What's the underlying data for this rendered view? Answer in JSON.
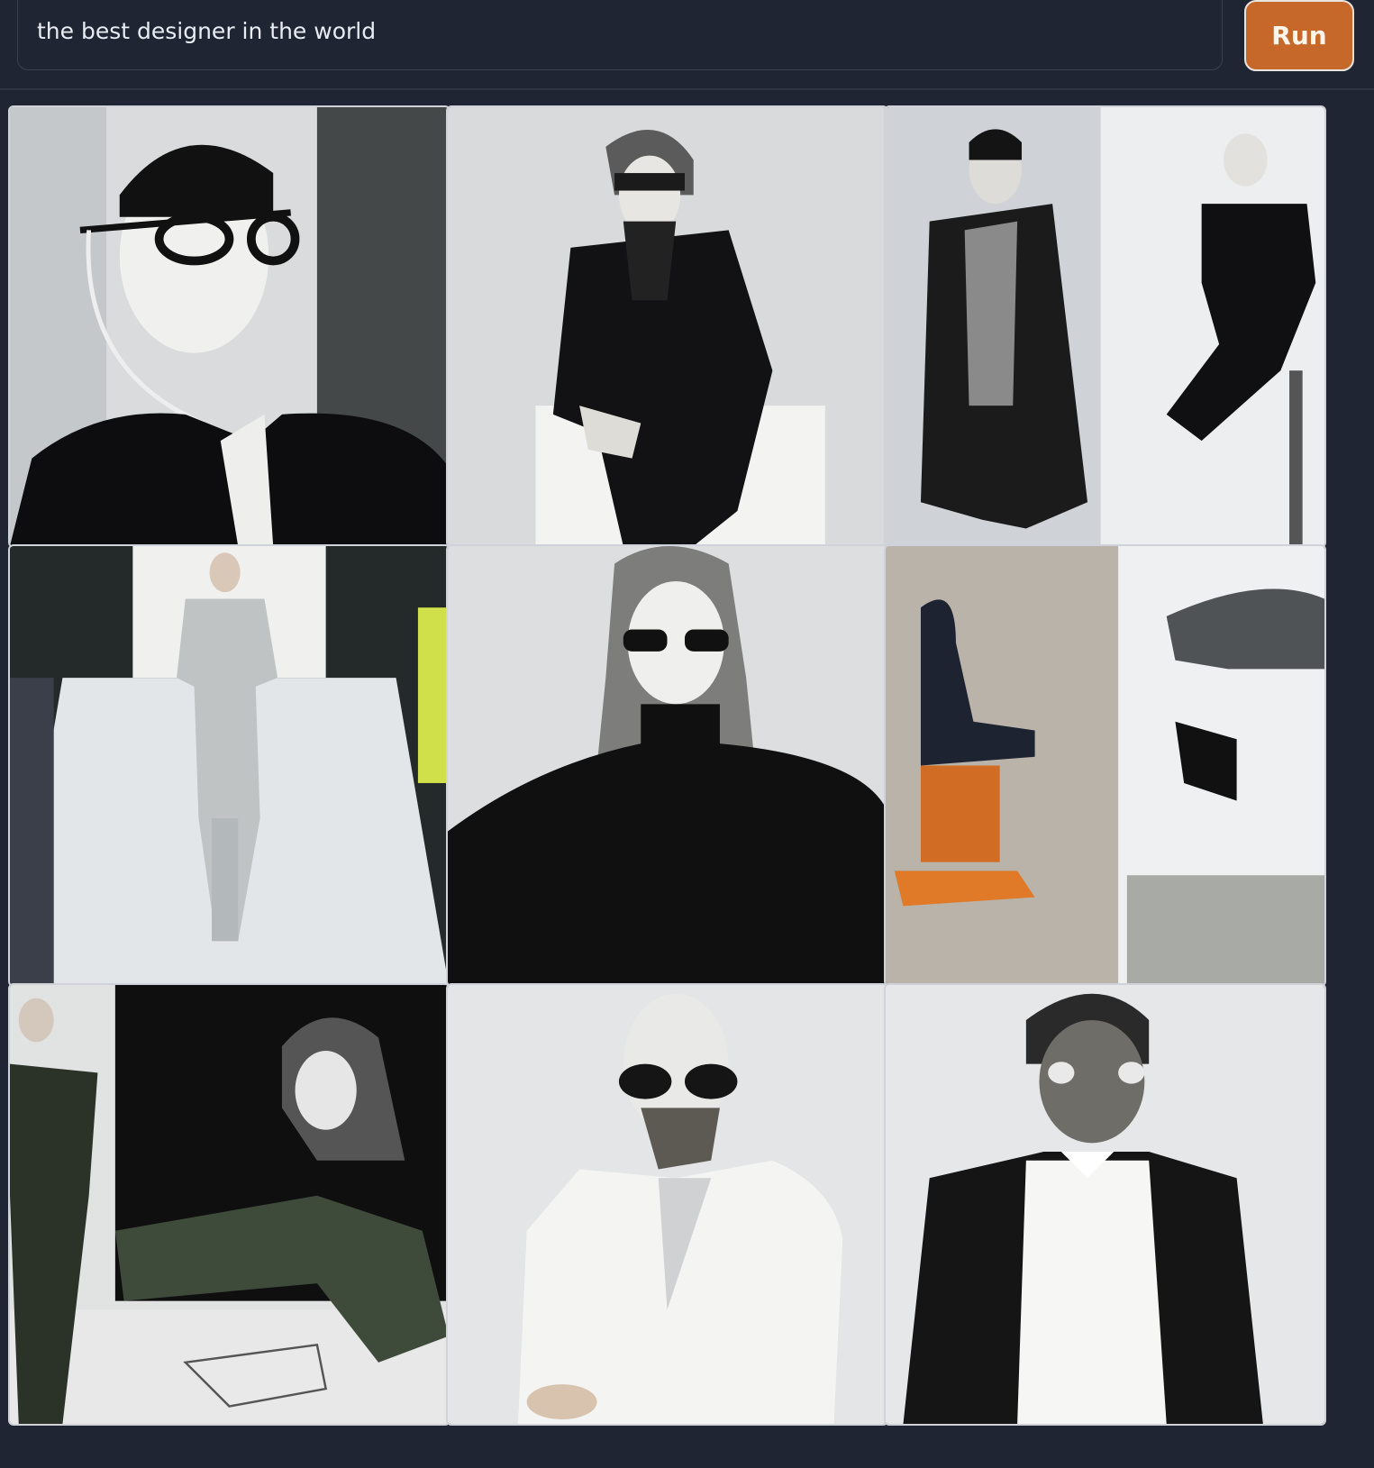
{
  "prompt": {
    "value": "the best designer in the world"
  },
  "run_button": {
    "label": "Run"
  },
  "colors": {
    "background": "#1f2532",
    "accent": "#c7682b"
  },
  "results": {
    "count": 9,
    "images": [
      {
        "subject": "man in black blazer with large glasses"
      },
      {
        "subject": "man in dark suit seated on white block"
      },
      {
        "subject": "two figures in dark coats against white wall"
      },
      {
        "subject": "model walking a white runway"
      },
      {
        "subject": "woman in black turtleneck with sunglasses"
      },
      {
        "subject": "chairs and fabric collage"
      },
      {
        "subject": "figures in knit outfits on black backdrop"
      },
      {
        "subject": "bald figure in white jacket with sunglasses"
      },
      {
        "subject": "man in black jacket and white shirt"
      }
    ]
  }
}
